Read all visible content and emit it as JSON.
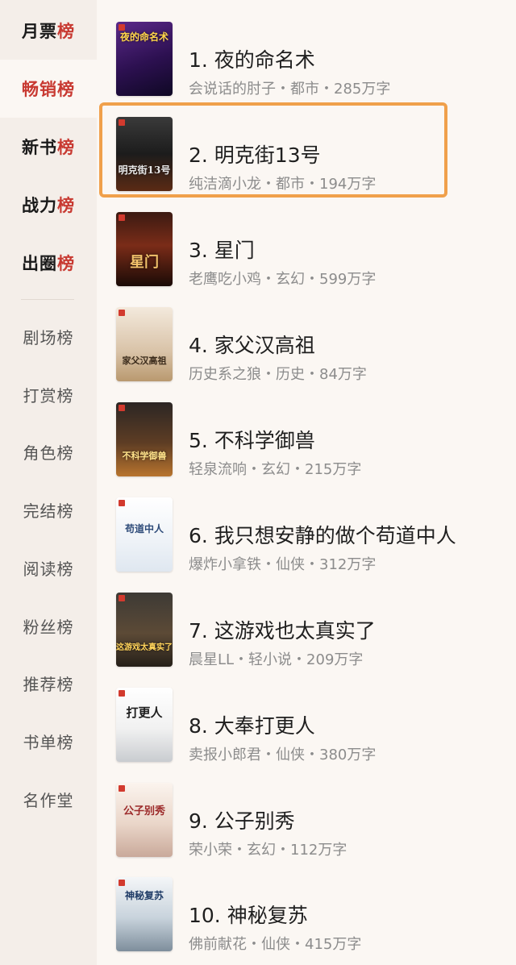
{
  "sidebar": {
    "primary_items": [
      {
        "label_main": "月票",
        "label_hl": "榜"
      },
      {
        "label_main": "畅销",
        "label_hl": "榜"
      },
      {
        "label_main": "新书",
        "label_hl": "榜"
      },
      {
        "label_main": "战力",
        "label_hl": "榜"
      },
      {
        "label_main": "出圈",
        "label_hl": "榜"
      }
    ],
    "active_item": "畅销榜",
    "secondary_items": [
      "剧场榜",
      "打赏榜",
      "角色榜",
      "完结榜",
      "阅读榜",
      "粉丝榜",
      "推荐榜",
      "书单榜",
      "名作堂"
    ]
  },
  "books": [
    {
      "title": "1. 夜的命名术",
      "meta": "会说话的肘子・都市・285万字",
      "cover_text": "夜的命名术"
    },
    {
      "title": "2. 明克街13号",
      "meta": "纯洁滴小龙・都市・194万字",
      "cover_text": "明克街13号",
      "highlighted": true
    },
    {
      "title": "3. 星门",
      "meta": "老鹰吃小鸡・玄幻・599万字",
      "cover_text": "星门"
    },
    {
      "title": "4. 家父汉高祖",
      "meta": "历史系之狼・历史・84万字",
      "cover_text": "家父汉高祖"
    },
    {
      "title": "5. 不科学御兽",
      "meta": "轻泉流响・玄幻・215万字",
      "cover_text": "不科学御兽"
    },
    {
      "title": "6. 我只想安静的做个苟道中人",
      "meta": "爆炸小拿铁・仙侠・312万字",
      "cover_text": "苟道中人"
    },
    {
      "title": "7. 这游戏也太真实了",
      "meta": "晨星LL・轻小说・209万字",
      "cover_text": "这游戏太真实了"
    },
    {
      "title": "8. 大奉打更人",
      "meta": "卖报小郎君・仙侠・380万字",
      "cover_text": "打更人"
    },
    {
      "title": "9. 公子别秀",
      "meta": "荣小荣・玄幻・112万字",
      "cover_text": "公子别秀"
    },
    {
      "title": "10. 神秘复苏",
      "meta": "佛前献花・仙侠・415万字",
      "cover_text": "神秘复苏"
    }
  ],
  "colors": {
    "accent": "#c83a32",
    "highlight_border": "#f0a04b",
    "meta_text": "#8c8c8c"
  }
}
